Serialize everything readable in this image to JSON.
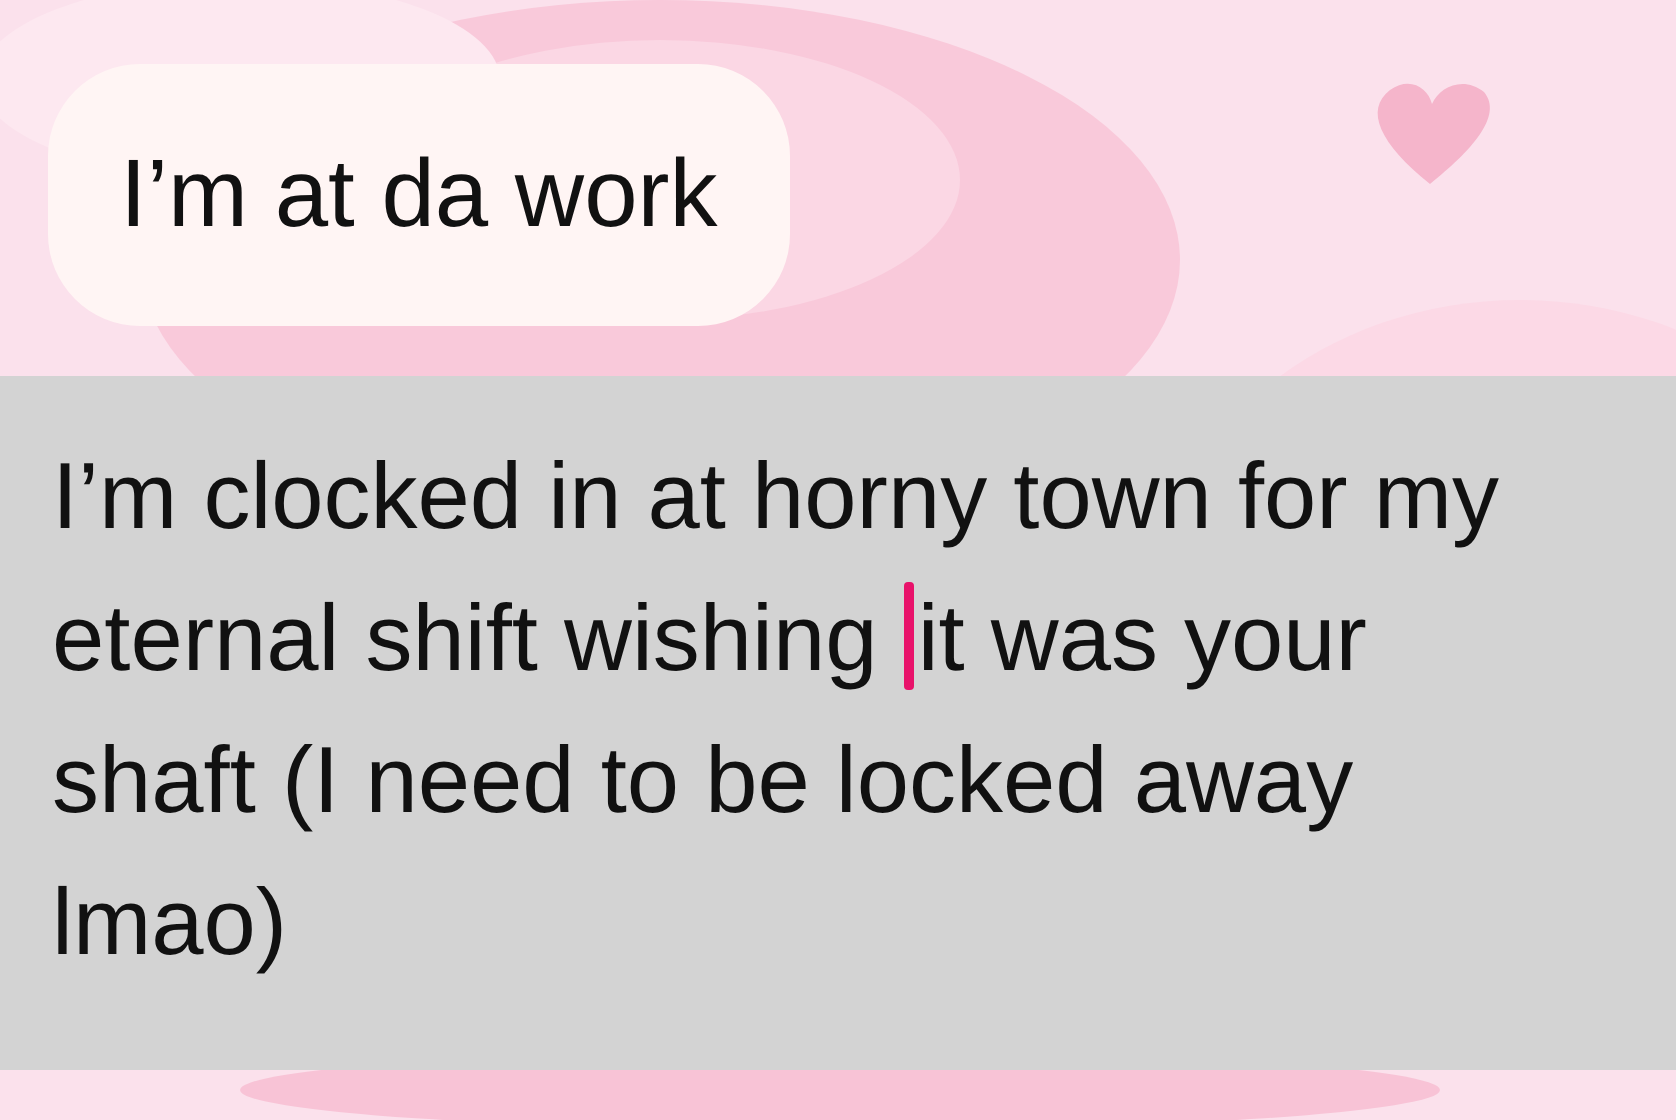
{
  "messages": [
    {
      "text": "I’m at da work"
    }
  ],
  "composer": {
    "value_before_cursor": "I’m clocked in at horny town for my eternal shift wishing ",
    "value_after_cursor": "it was your shaft (I need to be locked away lmao)"
  }
}
